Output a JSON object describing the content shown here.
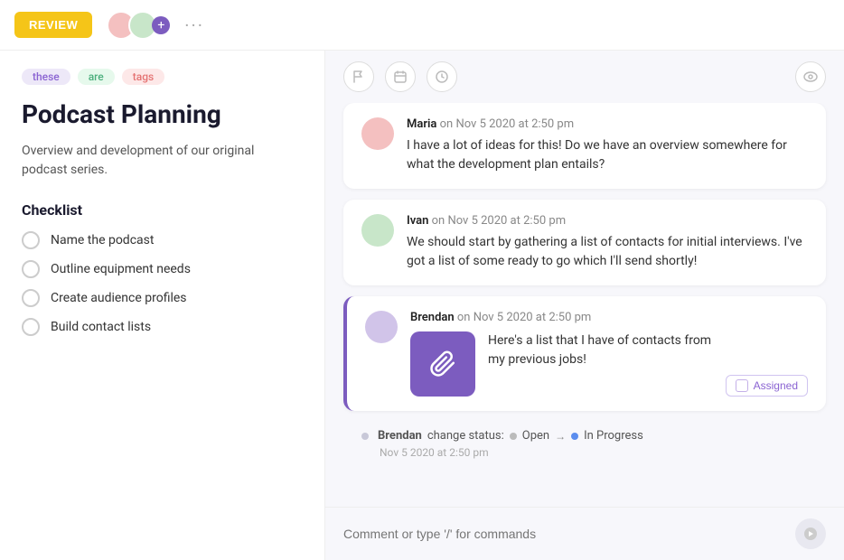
{
  "header": {
    "review_label": "REVIEW",
    "dots": "···",
    "eye_icon": "👁"
  },
  "tags": [
    {
      "label": "these",
      "style": "purple"
    },
    {
      "label": "are",
      "style": "green"
    },
    {
      "label": "tags",
      "style": "red"
    }
  ],
  "page": {
    "title": "Podcast Planning",
    "description": "Overview and development of our original podcast series."
  },
  "checklist": {
    "title": "Checklist",
    "items": [
      "Name the podcast",
      "Outline equipment needs",
      "Create audience profiles",
      "Build contact lists"
    ]
  },
  "toolbar": {
    "flag_icon": "⚑",
    "calendar_icon": "▭",
    "clock_icon": "◷",
    "eye_icon": "◉"
  },
  "comments": [
    {
      "author": "Maria",
      "meta": "on Nov 5 2020 at 2:50 pm",
      "text": "I have a lot of ideas for this! Do we have an overview somewhere for what the development plan entails?",
      "avatar_style": "maria"
    },
    {
      "author": "Ivan",
      "meta": "on Nov 5 2020 at 2:50 pm",
      "text": "We should start by gathering a list of contacts for initial interviews. I've got a list of some ready to go which I'll send shortly!",
      "avatar_style": "ivan"
    }
  ],
  "brendan_comment": {
    "author": "Brendan",
    "meta": "on Nov 5 2020 at 2:50 pm",
    "text": "Here's a list that I have of contacts from my previous jobs!",
    "assigned_label": "Assigned",
    "attachment_icon": "🖇"
  },
  "status_change": {
    "actor": "Brendan",
    "action": "change status:",
    "from": "Open",
    "to": "In Progress",
    "timestamp": "Nov 5 2020 at 2:50 pm"
  },
  "comment_input": {
    "placeholder": "Comment or type '/' for commands"
  }
}
